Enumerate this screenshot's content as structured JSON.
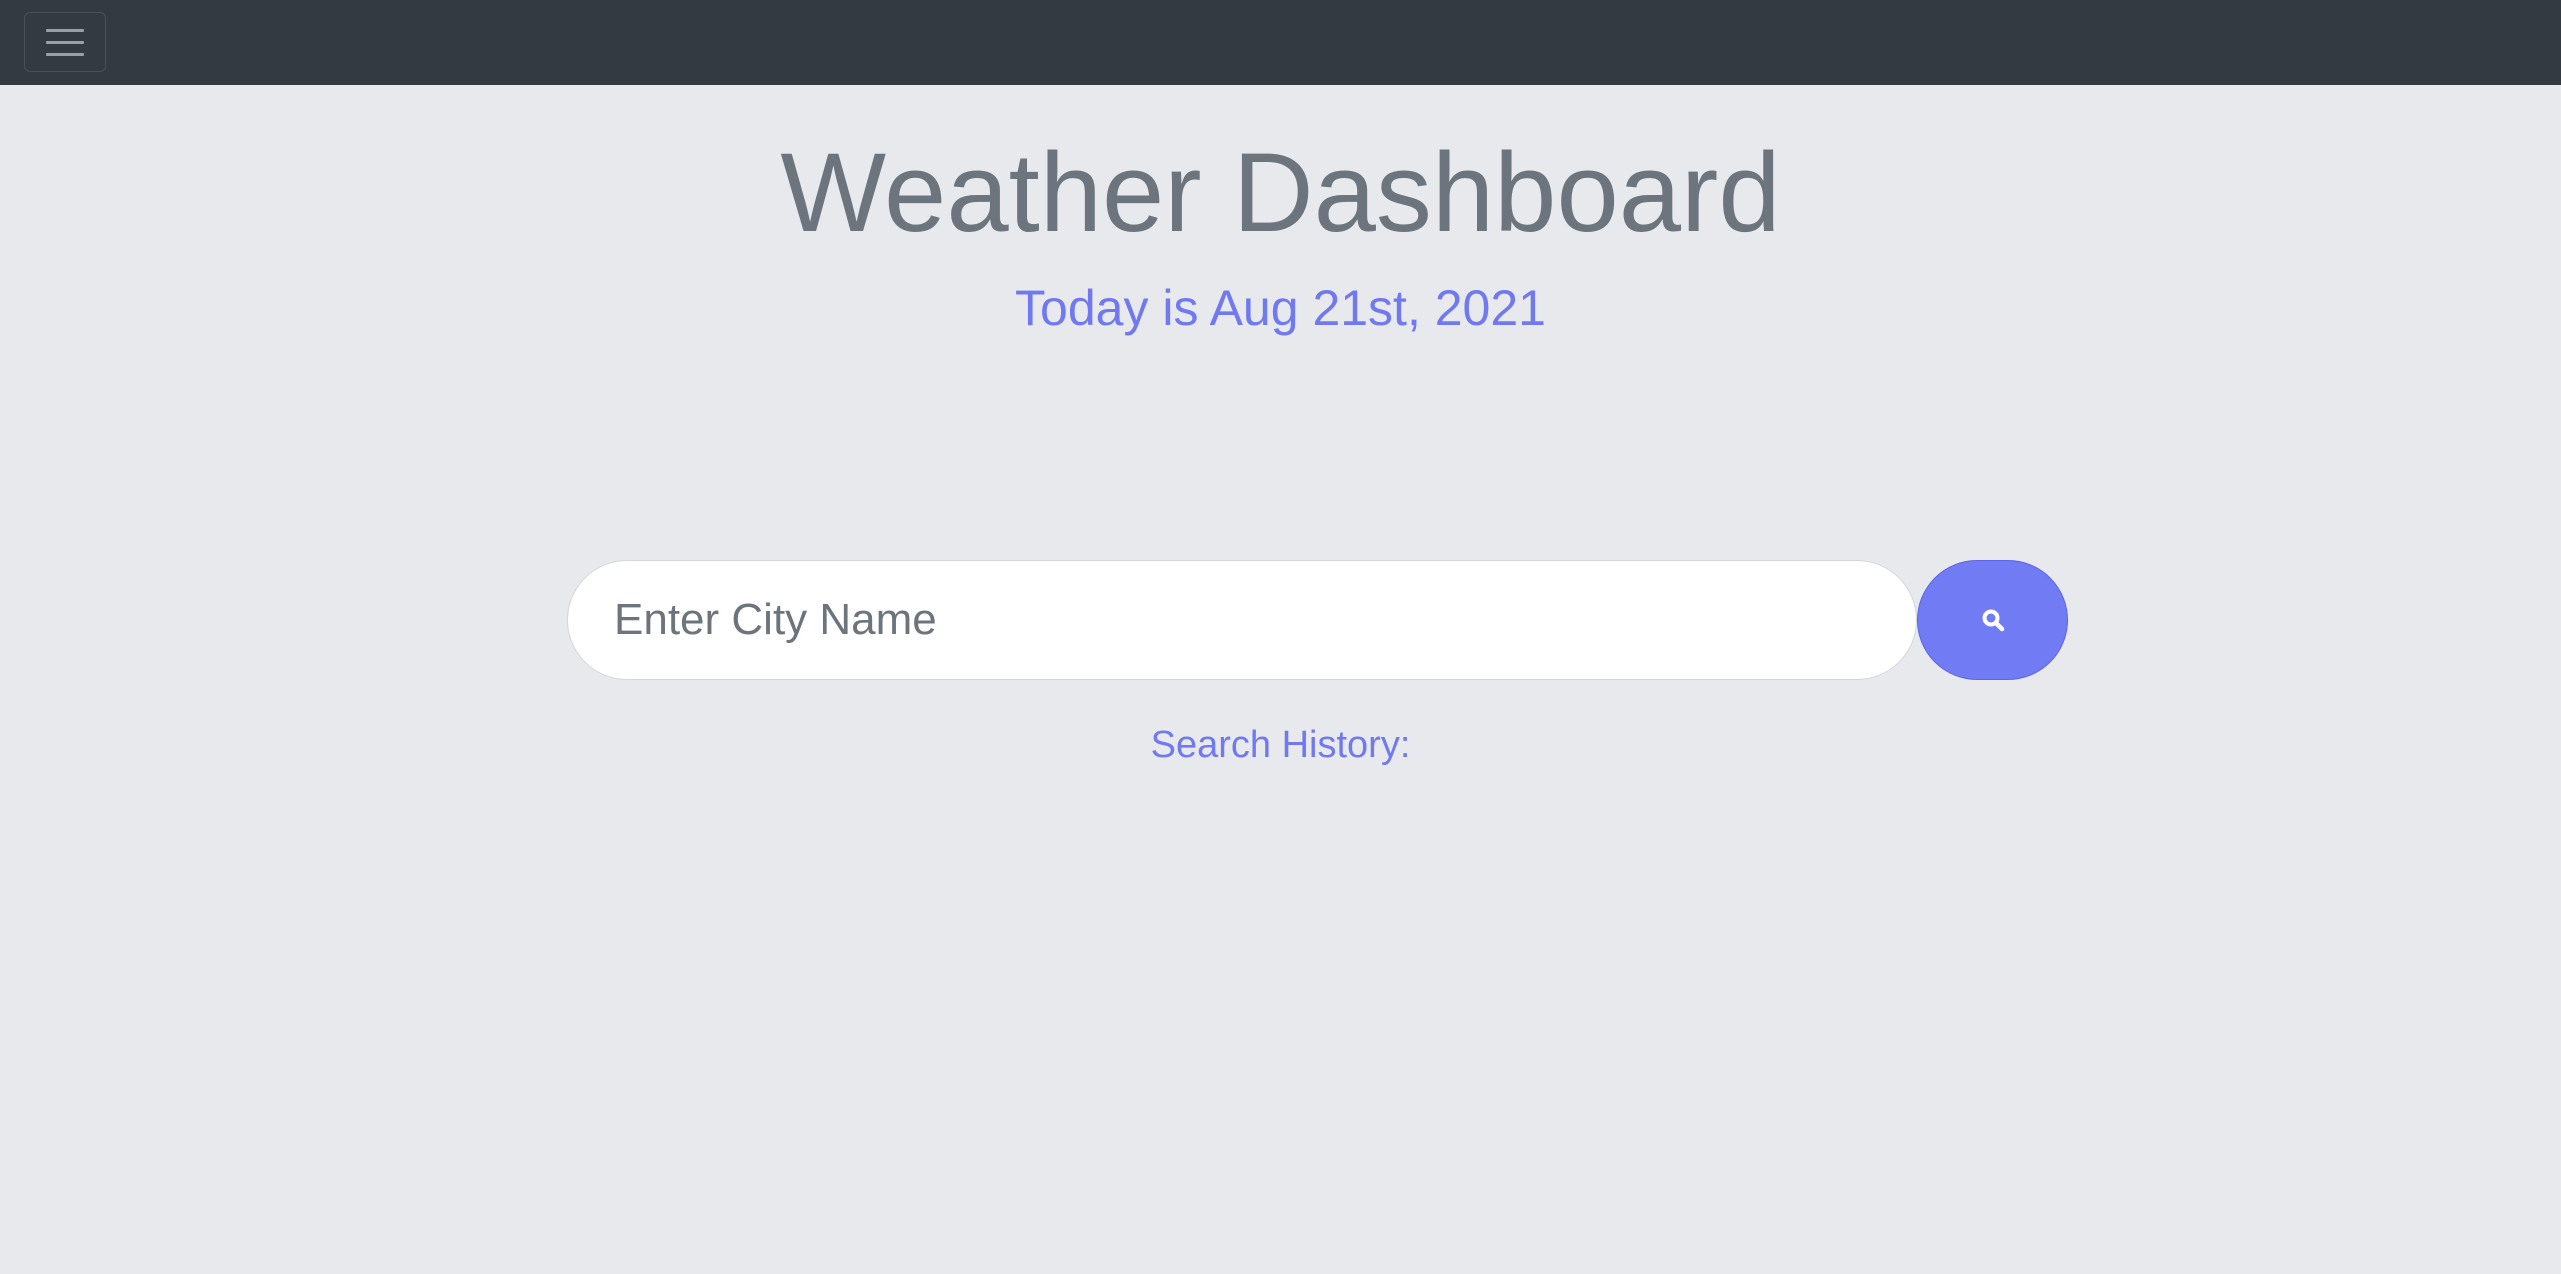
{
  "navbar": {
    "menu_icon": "hamburger-menu-icon"
  },
  "header": {
    "title": "Weather Dashboard",
    "date_text": "Today is Aug 21st, 2021"
  },
  "search": {
    "placeholder": "Enter City Name",
    "value": "",
    "button_icon": "search-icon"
  },
  "history": {
    "label": "Search History:",
    "items": []
  },
  "colors": {
    "navbar_bg": "#343a42",
    "page_bg": "#e7e9ec",
    "accent": "#717cf4",
    "title_text": "#6c757d"
  }
}
